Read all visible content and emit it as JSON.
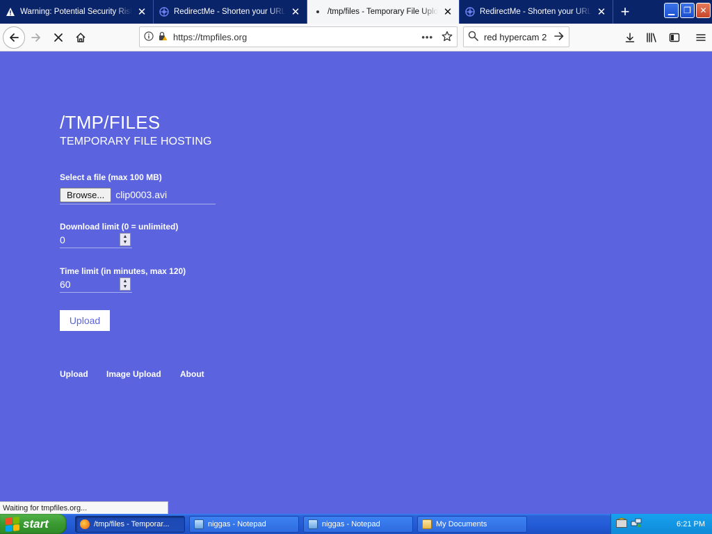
{
  "browser": {
    "tabs": [
      {
        "title": "Warning: Potential Security Risk Ahead",
        "icon": "warning-icon",
        "active": false
      },
      {
        "title": "RedirectMe - Shorten your URL to redirect",
        "icon": "globe-icon",
        "active": false
      },
      {
        "title": "/tmp/files - Temporary File Upload",
        "icon": "loading-icon",
        "active": true
      },
      {
        "title": "RedirectMe - Shorten your URL to redirect",
        "icon": "globe-icon",
        "active": false
      }
    ],
    "new_tab": "+",
    "url": "https://tmpfiles.org",
    "page_actions": "•••",
    "search_text": "red hypercam 2",
    "window_controls": {
      "minimize": "▁",
      "restore": "❐",
      "close": "✕"
    }
  },
  "page": {
    "title": "/TMP/FILES",
    "subtitle": "TEMPORARY FILE HOSTING",
    "file_label": "Select a file (max 100 MB)",
    "browse_label": "Browse...",
    "file_name": "clip0003.avi",
    "download_label": "Download limit (0 = unlimited)",
    "download_value": "0",
    "time_label": "Time limit (in minutes, max 120)",
    "time_value": "60",
    "upload_button": "Upload",
    "footer_links": [
      "Upload",
      "Image Upload",
      "About"
    ],
    "accent_color": "#5b64de"
  },
  "status": {
    "text": "Waiting for tmpfiles.org..."
  },
  "taskbar": {
    "start_label": "start",
    "buttons": [
      {
        "label": "/tmp/files - Temporar...",
        "active": true
      },
      {
        "label": "niggas - Notepad",
        "active": false
      },
      {
        "label": "niggas - Notepad",
        "active": false
      },
      {
        "label": "My Documents",
        "active": false
      }
    ],
    "clock": "6:21 PM"
  }
}
